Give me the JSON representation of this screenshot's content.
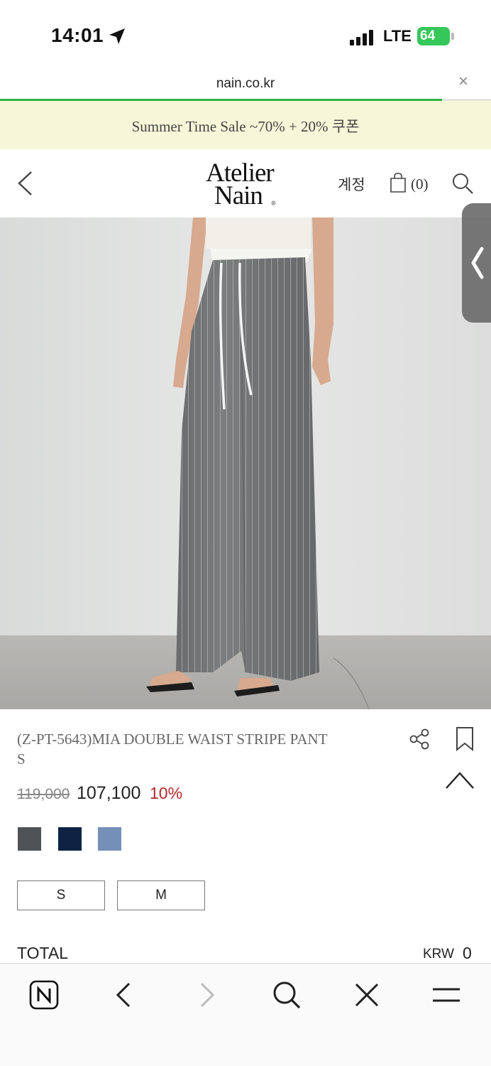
{
  "status_bar": {
    "time": "14:01",
    "network": "LTE",
    "battery": "64"
  },
  "browser": {
    "url": "nain.co.kr",
    "close_glyph": "×",
    "load_progress": 0.9
  },
  "banner": {
    "text": "Summer Time Sale ~70% + 20% 쿠폰"
  },
  "header": {
    "logo_line1": "Atelier",
    "logo_line2": "Nain",
    "logo_mark": "®",
    "account_label": "계정",
    "cart_count": "(0)"
  },
  "product": {
    "name": "(Z-PT-5643)MIA DOUBLE WAIST STRIPE PANT",
    "name_line2": "S",
    "original_price": "119,000",
    "sale_price": "107,100",
    "discount": "10%",
    "colors": [
      "#4f5356",
      "#0e2344",
      "#7490b8"
    ],
    "sizes": [
      "S",
      "M"
    ]
  },
  "total": {
    "label": "TOTAL",
    "currency": "KRW",
    "value": "0"
  },
  "toolbar": {
    "icons": [
      "naver-home-icon",
      "back-icon",
      "forward-icon",
      "search-icon",
      "close-icon",
      "menu-icon"
    ]
  }
}
